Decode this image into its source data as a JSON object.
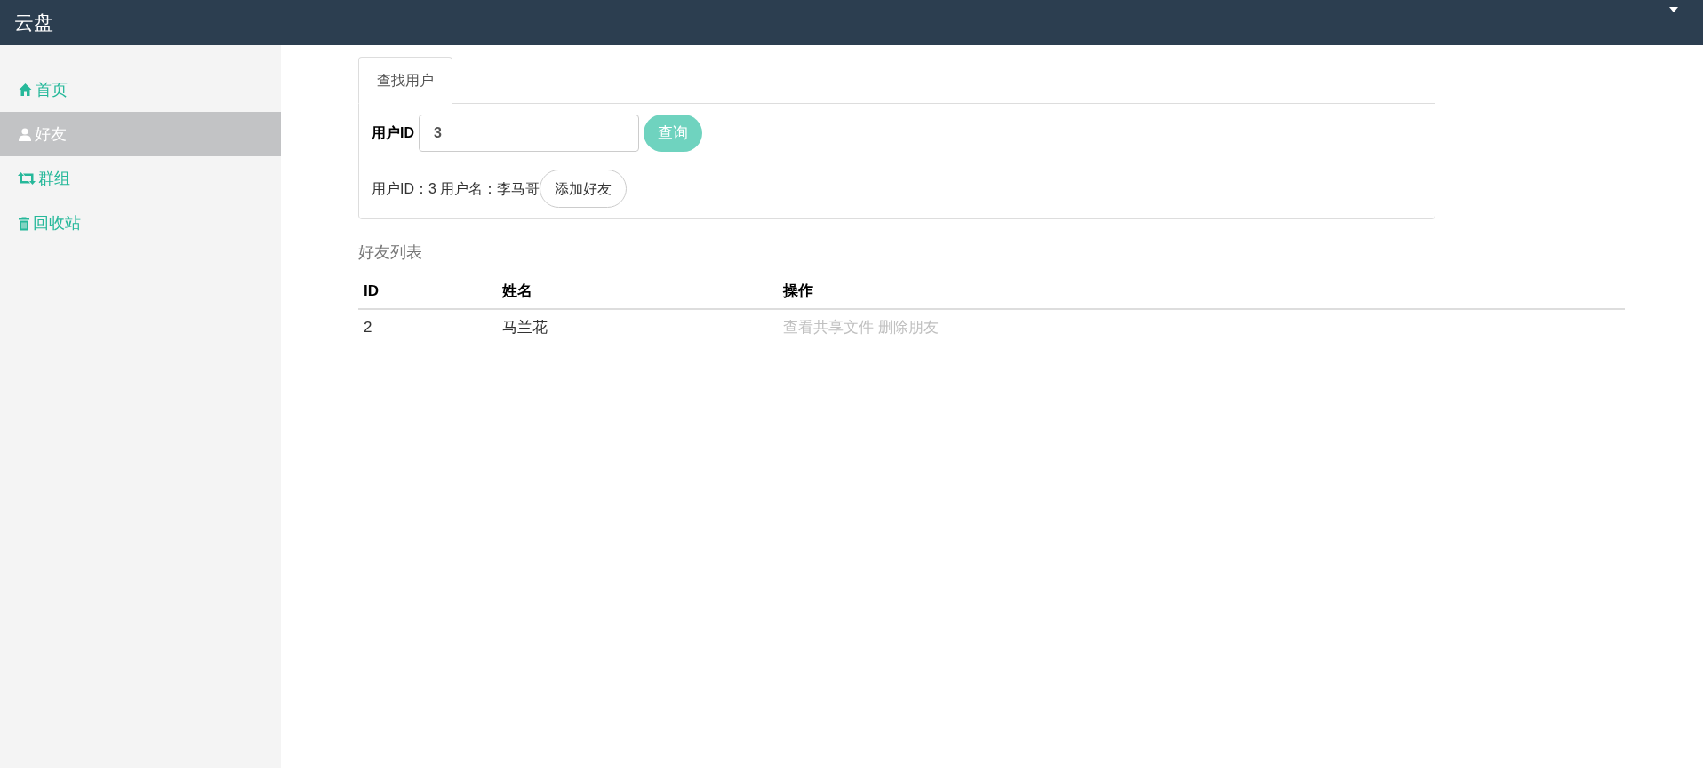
{
  "header": {
    "title": "云盘"
  },
  "sidebar": {
    "items": [
      {
        "label": "首页",
        "kind": "home",
        "selected": false
      },
      {
        "label": "好友",
        "kind": "user",
        "selected": true
      },
      {
        "label": "群组",
        "kind": "groups",
        "selected": false
      },
      {
        "label": "回收站",
        "kind": "trash",
        "selected": false
      }
    ]
  },
  "tabs": [
    {
      "label": "查找用户",
      "selected": true
    }
  ],
  "search": {
    "label": "用户ID",
    "value": "3",
    "button": "查询"
  },
  "result": {
    "text": "用户ID：3 用户名：李马哥",
    "button": "添加好友"
  },
  "friends": {
    "title": "好友列表",
    "columns": [
      "ID",
      "姓名",
      "操作"
    ],
    "rows": [
      {
        "id": "2",
        "name": "马兰花",
        "actions": [
          "查看共享文件",
          "删除朋友"
        ]
      }
    ]
  }
}
